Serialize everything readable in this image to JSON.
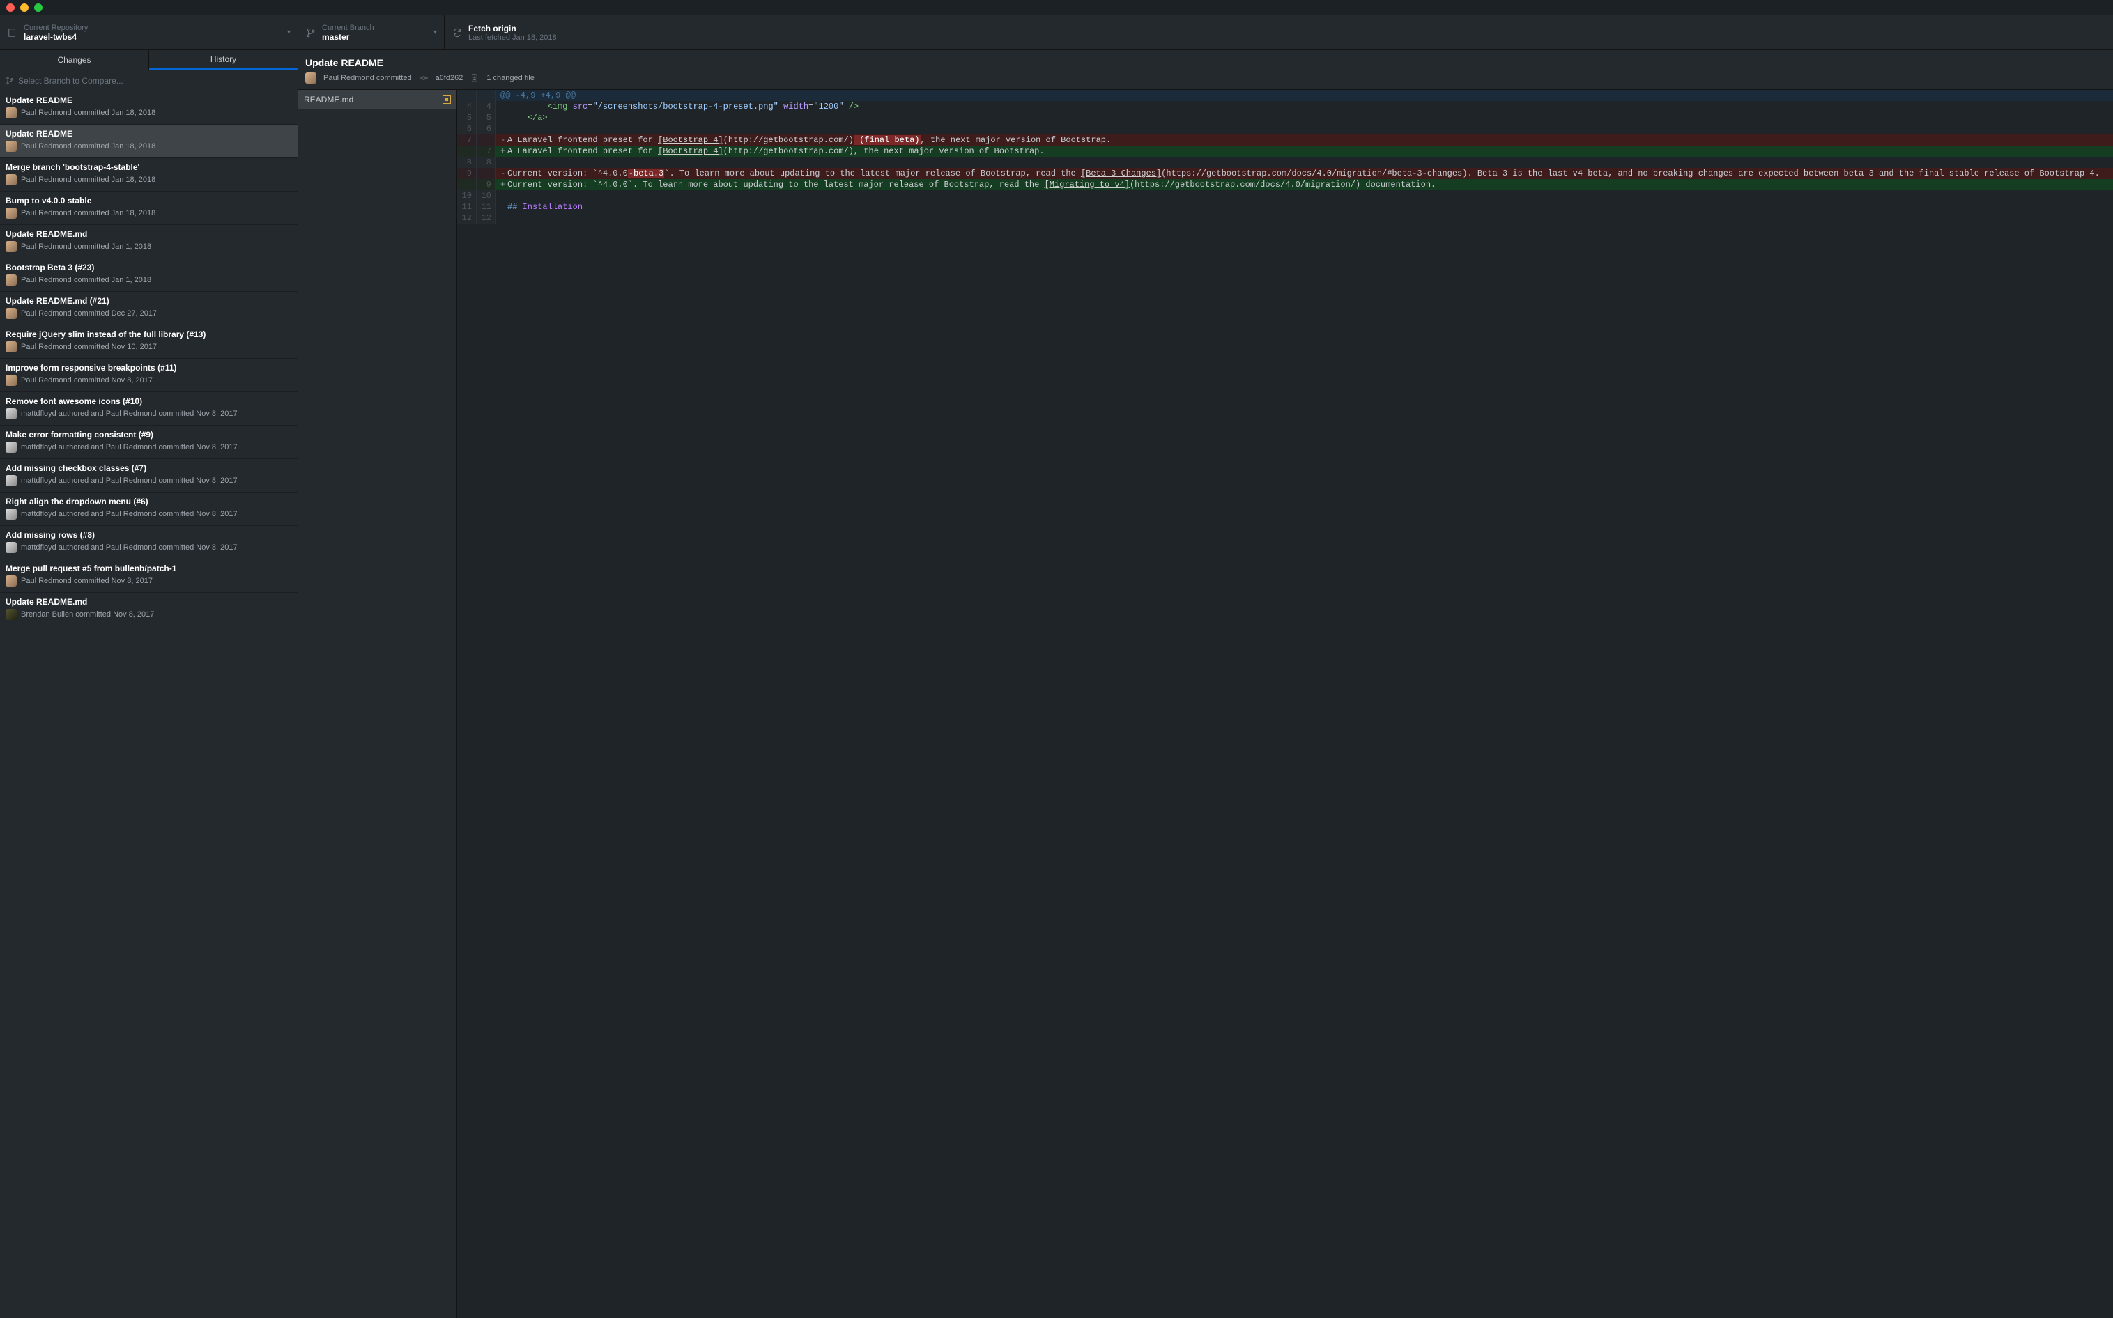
{
  "toolbar": {
    "repo_label": "Current Repository",
    "repo_value": "laravel-twbs4",
    "branch_label": "Current Branch",
    "branch_value": "master",
    "fetch_label": "Fetch origin",
    "fetch_sub": "Last fetched Jan 18, 2018"
  },
  "tabs": {
    "changes": "Changes",
    "history": "History"
  },
  "compare_placeholder": "Select Branch to Compare...",
  "commits": [
    {
      "title": "Update README",
      "meta": "Paul Redmond committed Jan 18, 2018",
      "avatar": "a1"
    },
    {
      "title": "Update README",
      "meta": "Paul Redmond committed Jan 18, 2018",
      "avatar": "a1",
      "selected": true
    },
    {
      "title": "Merge branch 'bootstrap-4-stable'",
      "meta": "Paul Redmond committed Jan 18, 2018",
      "avatar": "a1"
    },
    {
      "title": "Bump to v4.0.0 stable",
      "meta": "Paul Redmond committed Jan 18, 2018",
      "avatar": "a1"
    },
    {
      "title": "Update README.md",
      "meta": "Paul Redmond committed Jan 1, 2018",
      "avatar": "a1"
    },
    {
      "title": "Bootstrap Beta 3 (#23)",
      "meta": "Paul Redmond committed Jan 1, 2018",
      "avatar": "a1"
    },
    {
      "title": "Update README.md (#21)",
      "meta": "Paul Redmond committed Dec 27, 2017",
      "avatar": "a1"
    },
    {
      "title": "Require jQuery slim instead of the full library (#13)",
      "meta": "Paul Redmond committed Nov 10, 2017",
      "avatar": "a1"
    },
    {
      "title": "Improve form responsive breakpoints (#11)",
      "meta": "Paul Redmond committed Nov 8, 2017",
      "avatar": "a1"
    },
    {
      "title": "Remove font awesome icons (#10)",
      "meta": "mattdfloyd authored and Paul Redmond committed Nov 8, 2017",
      "avatar": "a2"
    },
    {
      "title": "Make error formatting consistent (#9)",
      "meta": "mattdfloyd authored and Paul Redmond committed Nov 8, 2017",
      "avatar": "a2"
    },
    {
      "title": "Add missing checkbox classes (#7)",
      "meta": "mattdfloyd authored and Paul Redmond committed Nov 8, 2017",
      "avatar": "a2"
    },
    {
      "title": "Right align the dropdown menu (#6)",
      "meta": "mattdfloyd authored and Paul Redmond committed Nov 8, 2017",
      "avatar": "a2"
    },
    {
      "title": "Add missing rows (#8)",
      "meta": "mattdfloyd authored and Paul Redmond committed Nov 8, 2017",
      "avatar": "a2"
    },
    {
      "title": "Merge pull request #5 from bullenb/patch-1",
      "meta": "Paul Redmond committed Nov 8, 2017",
      "avatar": "a1"
    },
    {
      "title": "Update README.md",
      "meta": "Brendan Bullen committed Nov 8, 2017",
      "avatar": "a3"
    }
  ],
  "detail": {
    "title": "Update README",
    "author": "Paul Redmond committed",
    "sha": "a6fd262",
    "changed": "1 changed file",
    "file": "README.md"
  },
  "diff": {
    "hunk": "@@ -4,9 +4,9 @@",
    "rows": [
      {
        "t": "ctx",
        "old": "4",
        "new": "4",
        "html": "        <span class='tok-tag'>&lt;img</span> <span class='tok-attr'>src</span>=<span class='tok-str'>\"/screenshots/bootstrap-4-preset.png\"</span> <span class='tok-attr'>width</span>=<span class='tok-str'>\"1200\"</span> <span class='tok-tag'>/&gt;</span>"
      },
      {
        "t": "ctx",
        "old": "5",
        "new": "5",
        "html": "    <span class='tok-tag'>&lt;/a&gt;</span>"
      },
      {
        "t": "ctx",
        "old": "6",
        "new": "6",
        "html": ""
      },
      {
        "t": "del",
        "old": "7",
        "new": "",
        "html": "A Laravel frontend preset for <span class='tok-link'>[Bootstrap 4]</span>(http://getbootstrap.com/)<span class='tok-hl-del'> (final beta)</span>, the next major version of Bootstrap."
      },
      {
        "t": "add",
        "old": "",
        "new": "7",
        "html": "A Laravel frontend preset for <span class='tok-link'>[Bootstrap 4]</span>(http://getbootstrap.com/), the next major version of Bootstrap."
      },
      {
        "t": "ctx",
        "old": "8",
        "new": "8",
        "html": ""
      },
      {
        "t": "del",
        "old": "9",
        "new": "",
        "html": "Current version: `^4.0.0<span class='tok-hl-del'>-beta.3</span>`. To learn more about updating to the latest major release of Bootstrap, read the <span class='tok-link'>[Beta 3 Changes]</span>(https://getbootstrap.com/docs/4.0/migration/#beta-3-changes). Beta 3 is the last v4 beta, and no breaking changes are expected between beta 3 and the final stable release of Bootstrap 4."
      },
      {
        "t": "add",
        "old": "",
        "new": "9",
        "html": "Current version: `^4.0.0`. To learn more about updating to the latest major release of Bootstrap, read the <span class='tok-link'>[Migrating to v4]</span>(https://getbootstrap.com/docs/4.0/migration/) documentation."
      },
      {
        "t": "ctx",
        "old": "10",
        "new": "10",
        "html": ""
      },
      {
        "t": "ctx",
        "old": "11",
        "new": "11",
        "html": "<span class='tok-head'>## </span><span class='tok-inst'>Installation</span>"
      },
      {
        "t": "ctx",
        "old": "12",
        "new": "12",
        "html": ""
      }
    ]
  }
}
